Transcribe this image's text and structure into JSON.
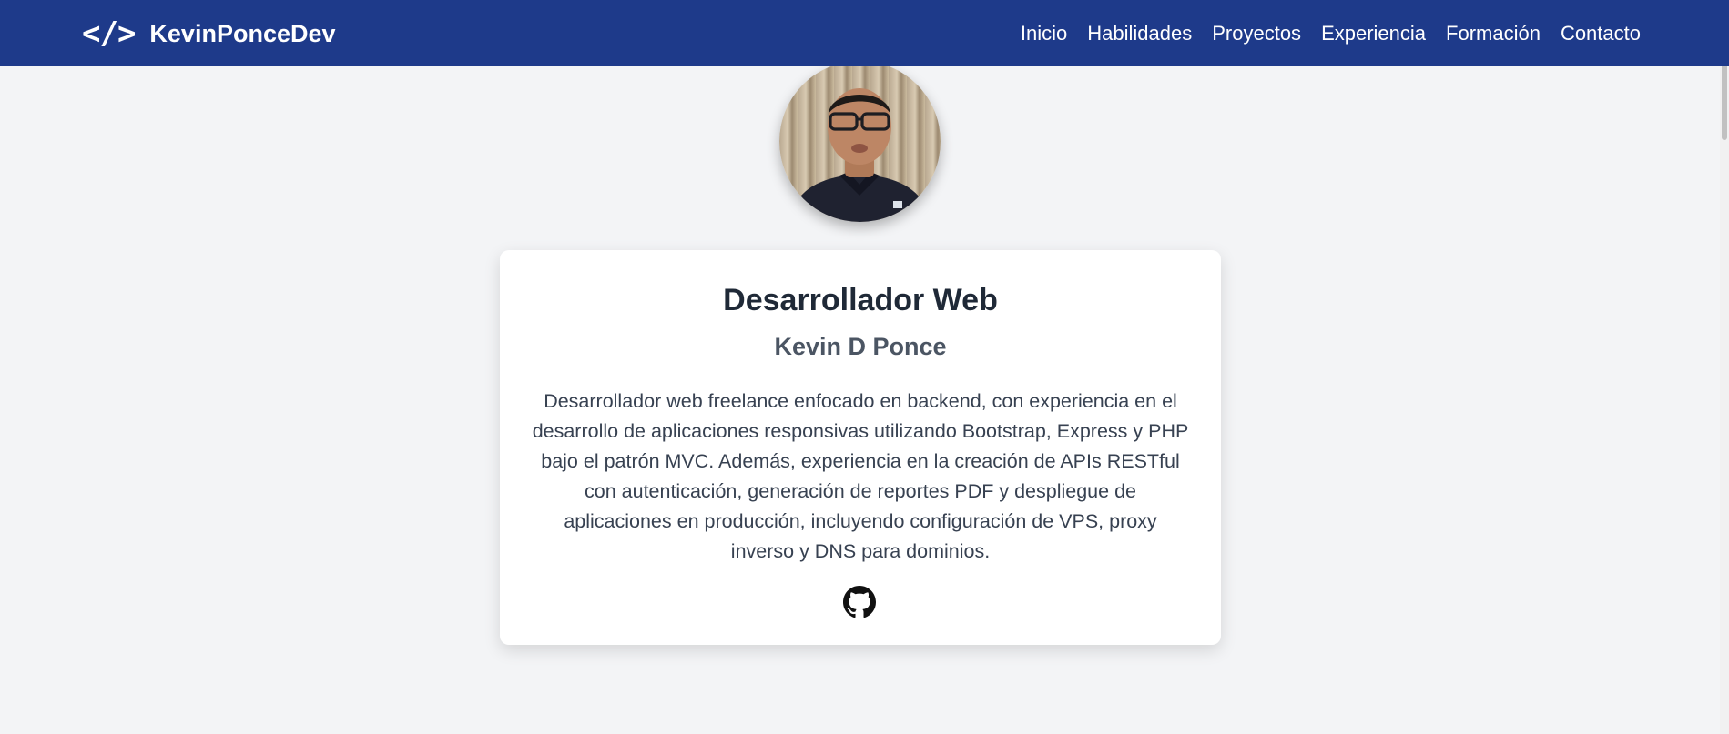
{
  "brand": {
    "icon": "</>",
    "name": "KevinPonceDev"
  },
  "nav": {
    "links": [
      {
        "label": "Inicio"
      },
      {
        "label": "Habilidades"
      },
      {
        "label": "Proyectos"
      },
      {
        "label": "Experiencia"
      },
      {
        "label": "Formación"
      },
      {
        "label": "Contacto"
      }
    ]
  },
  "hero": {
    "avatar_icon": "profile-photo",
    "title": "Desarrollador Web",
    "name": "Kevin D Ponce",
    "description": "Desarrollador web freelance enfocado en backend, con experiencia en el desarrollo de aplicaciones responsivas utilizando Bootstrap, Express y PHP bajo el patrón MVC. Además, experiencia en la creación de APIs RESTful con autenticación, generación de reportes PDF y despliegue de aplicaciones en producción, incluyendo configuración de VPS, proxy inverso y DNS para dominios.",
    "social_icon": "github-icon"
  },
  "colors": {
    "navbar": "#1e3a8a",
    "background": "#f3f4f6",
    "card": "#ffffff",
    "title_text": "#1f2937",
    "subtitle_text": "#4b5563"
  }
}
